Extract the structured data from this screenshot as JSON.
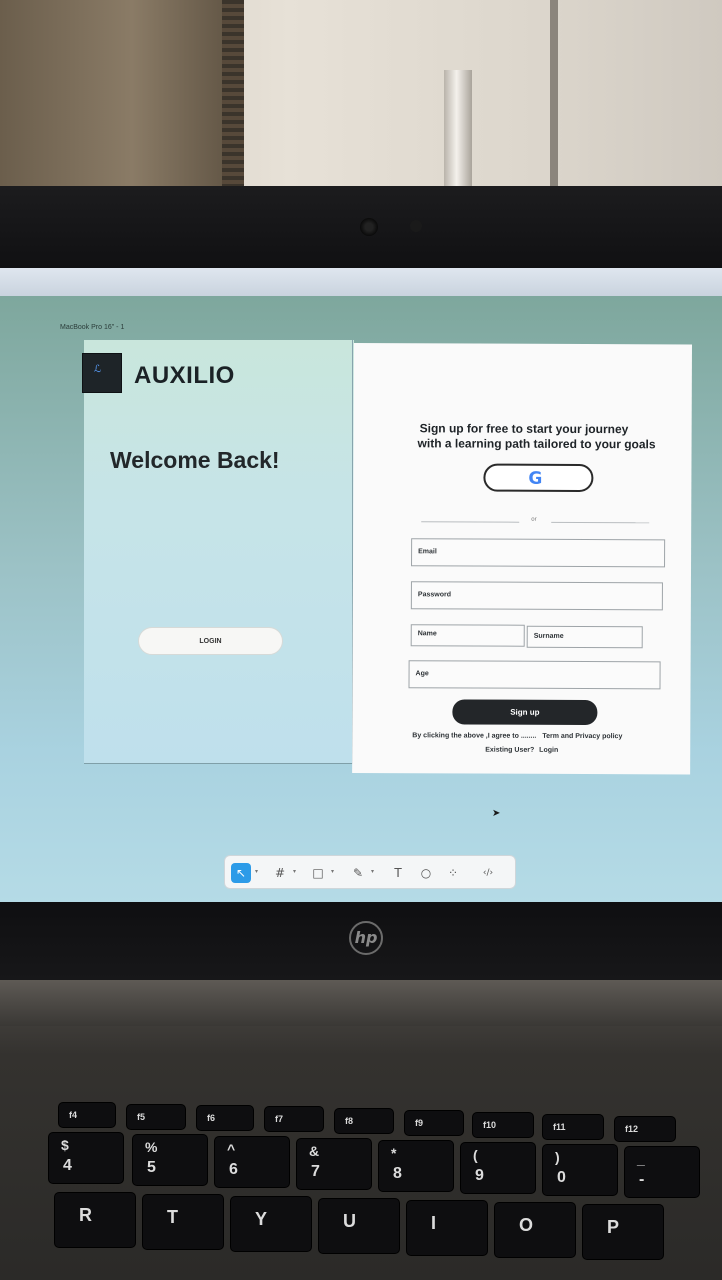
{
  "figma": {
    "frame_label": "MacBook Pro 16\" - 1"
  },
  "left_panel": {
    "brand": "AUXILIO",
    "welcome": "Welcome Back!",
    "login_button": "LOGIN"
  },
  "right_panel": {
    "headline_line1": "Sign up for free to start your journey",
    "headline_line2": "with a learning path tailored to your goals",
    "google_icon": "G",
    "or_text": "or",
    "email_label": "Email",
    "password_label": "Password",
    "name_label": "Name",
    "surname_label": "Surname",
    "age_label": "Age",
    "signup_button": "Sign up",
    "terms_text": "By clicking the above ,I agree to ........",
    "terms_link": "Term and Privacy policy",
    "existing_text": "Existing User?",
    "existing_link": "Login"
  },
  "toolbar": {
    "tools": [
      "move-tool-icon",
      "frame-tool-icon",
      "shape-tool-icon",
      "pen-tool-icon",
      "text-tool-icon",
      "comment-tool-icon",
      "components-icon",
      "dev-mode-icon"
    ],
    "text_tool": "T"
  },
  "device": {
    "logo": "hp"
  },
  "keyboard": {
    "fkeys": [
      "f4",
      "f5",
      "f6",
      "f7",
      "f8",
      "f9",
      "f10",
      "f11",
      "f12"
    ],
    "number_row": [
      {
        "top": "$",
        "bottom": "4"
      },
      {
        "top": "%",
        "bottom": "5"
      },
      {
        "top": "^",
        "bottom": "6"
      },
      {
        "top": "&",
        "bottom": "7"
      },
      {
        "top": "*",
        "bottom": "8"
      },
      {
        "top": "(",
        "bottom": "9"
      },
      {
        "top": ")",
        "bottom": "0"
      },
      {
        "top": "_",
        "bottom": "-"
      }
    ],
    "letter_row": [
      "R",
      "T",
      "Y",
      "U",
      "I",
      "O",
      "P"
    ]
  }
}
